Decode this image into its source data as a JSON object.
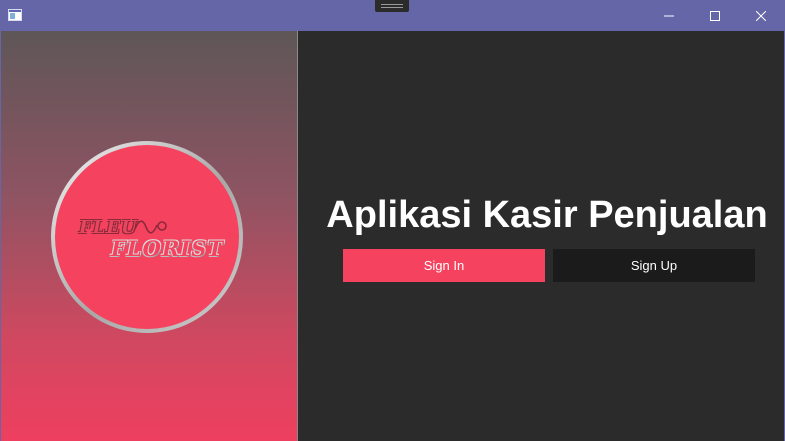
{
  "window": {
    "controls": [
      "minimize-icon",
      "maximize-icon",
      "close-icon"
    ]
  },
  "logo": {
    "line1": "FLEU",
    "line2": "FLORIST"
  },
  "main": {
    "title": "Aplikasi Kasir Penjualan",
    "signin_label": "Sign In",
    "signup_label": "Sign Up"
  },
  "colors": {
    "accent": "#f4425f",
    "titlebar": "#6466a8",
    "panel": "#2b2b2b",
    "signup_button": "#1b1b1b"
  }
}
